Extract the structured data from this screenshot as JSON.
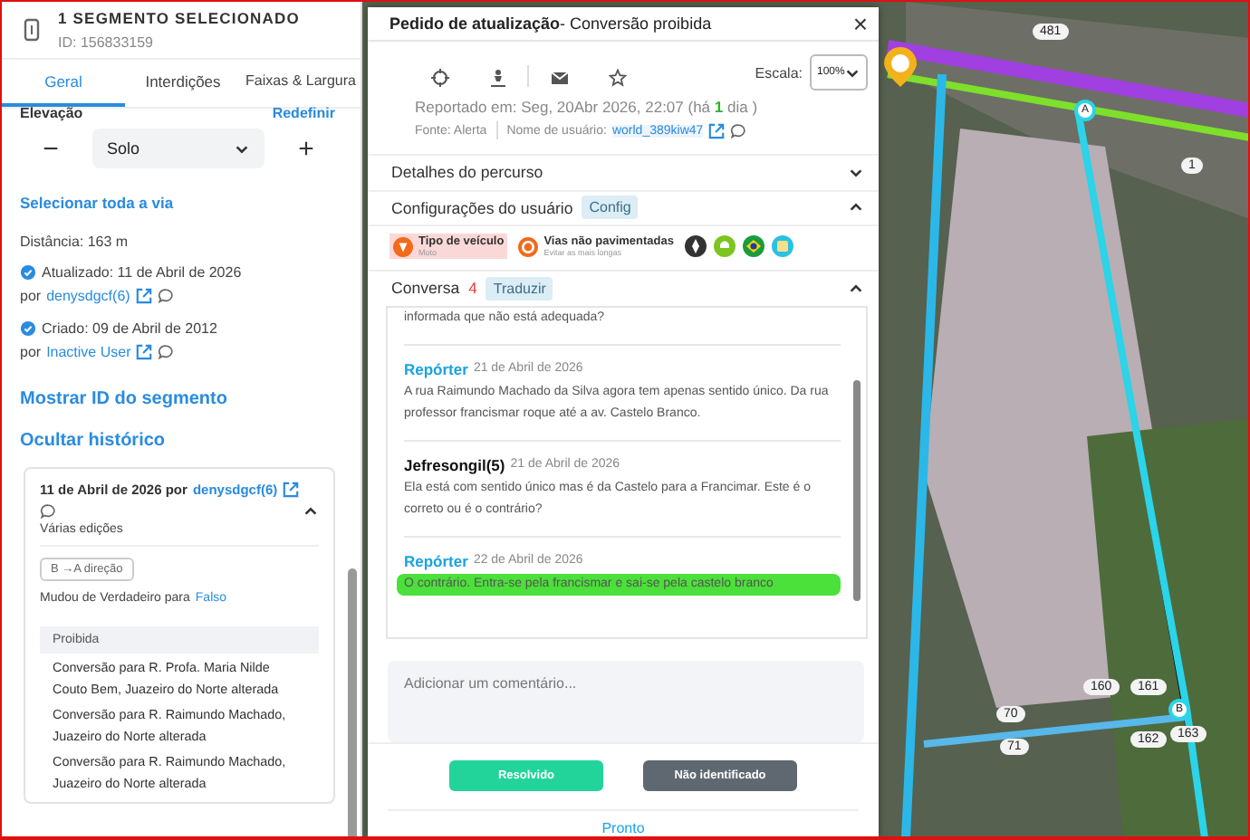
{
  "segment_panel": {
    "title": "1 SEGMENTO SELECIONADO",
    "id": "ID: 156833159",
    "tabs": [
      {
        "label": "Geral",
        "selected": true
      },
      {
        "label": "Interdições",
        "selected": false
      },
      {
        "label": "Faixas & Largura",
        "selected": false
      }
    ],
    "elevation": {
      "label": "Elevação",
      "reset": "Redefinir",
      "minus": "−",
      "value": "Solo",
      "plus": "+"
    },
    "select_road_link": "Selecionar toda a via",
    "distance": "Distância: 163 m",
    "updated": {
      "text": "Atualizado: 11 de Abril de 2026",
      "by": "por",
      "user": "denysdgcf(6)"
    },
    "created": {
      "text": "Criado: 09 de Abril de 2012",
      "by": "por",
      "user": "Inactive User"
    },
    "links": [
      "Mostrar ID do segmento",
      "Ocultar histórico"
    ],
    "history": {
      "date": "11 de Abril de 2026 por",
      "user": "denysdgcf(6)",
      "expanded": true,
      "summary": "Várias edições",
      "chip": "B →A direção",
      "change": "Mudou de Verdadeiro para",
      "new_value": "Falso",
      "group": "Proibida",
      "items": [
        "Conversão para R. Profa. Maria Nilde Couto Bem, Juazeiro do Norte alterada",
        "Conversão para R. Raimundo Machado, Juazeiro do Norte alterada",
        "Conversão para R. Raimundo Machado, Juazeiro do Norte alterada"
      ]
    }
  },
  "report_dialog": {
    "title": "Pedido de atualização",
    "subtitle": "- Conversão proibida",
    "close": "×",
    "scale_label": "Escala:",
    "scale_value": "100%",
    "reported": "Reportado em: Seg, 20Abr 2026, 22:07 (há **1** dia )",
    "source": "Fonte: Alerta",
    "username_label": "Nome de usuário:",
    "username": "world_389kiw47",
    "sections": [
      {
        "title": "Detalhes do percurso",
        "expanded": false
      },
      {
        "title": "Configurações do usuário",
        "tag": "Config",
        "expanded": true
      }
    ],
    "settings": [
      {
        "title": "Tipo de veículo",
        "note": "Moto",
        "highlighted": true
      },
      {
        "title": "Vias não pavimentadas",
        "note": "Evitar as mais longas",
        "highlighted": false
      }
    ],
    "conversation": {
      "title": "Conversa",
      "count": "4",
      "tag": "Traduzir",
      "expanded": true,
      "messages": [
        {
          "kind": "continuation",
          "text": "informada que não está adequada?",
          "highlighted": false
        },
        {
          "kind": "reporter",
          "author": "Repórter",
          "date": "21 de Abril de 2026",
          "text": "A rua Raimundo Machado da Silva agora tem apenas sentido único. Da rua professor francismar roque até a av. Castelo Branco.",
          "highlighted": false
        },
        {
          "kind": "user",
          "author": "Jefresongil(5)",
          "date": "21 de Abril de 2026",
          "text": "Ela está com sentido único mas é da Castelo para a Francimar. Este é o correto ou é o contrário?",
          "highlighted": false
        },
        {
          "kind": "reporter",
          "author": "Repórter",
          "date": "22 de Abril de 2026",
          "text": "O contrário. Entra-se pela francismar e sai-se pela castelo branco",
          "highlighted": true
        }
      ]
    },
    "comment_placeholder": "Adicionar um comentário...",
    "buttons": [
      {
        "label": "Resolvido",
        "kind": "primary"
      },
      {
        "label": "Não identificado",
        "kind": "secondary"
      }
    ],
    "done": "Pronto"
  },
  "map": {
    "markers": [
      {
        "label": "481",
        "kind": "segment"
      },
      {
        "label": "1",
        "kind": "segment"
      },
      {
        "label": "A",
        "kind": "node"
      },
      {
        "label": "160",
        "kind": "segment"
      },
      {
        "label": "161",
        "kind": "segment"
      },
      {
        "label": "B",
        "kind": "node"
      },
      {
        "label": "70",
        "kind": "segment"
      },
      {
        "label": "71",
        "kind": "segment"
      },
      {
        "label": "162",
        "kind": "segment"
      },
      {
        "label": "163",
        "kind": "segment"
      }
    ]
  }
}
